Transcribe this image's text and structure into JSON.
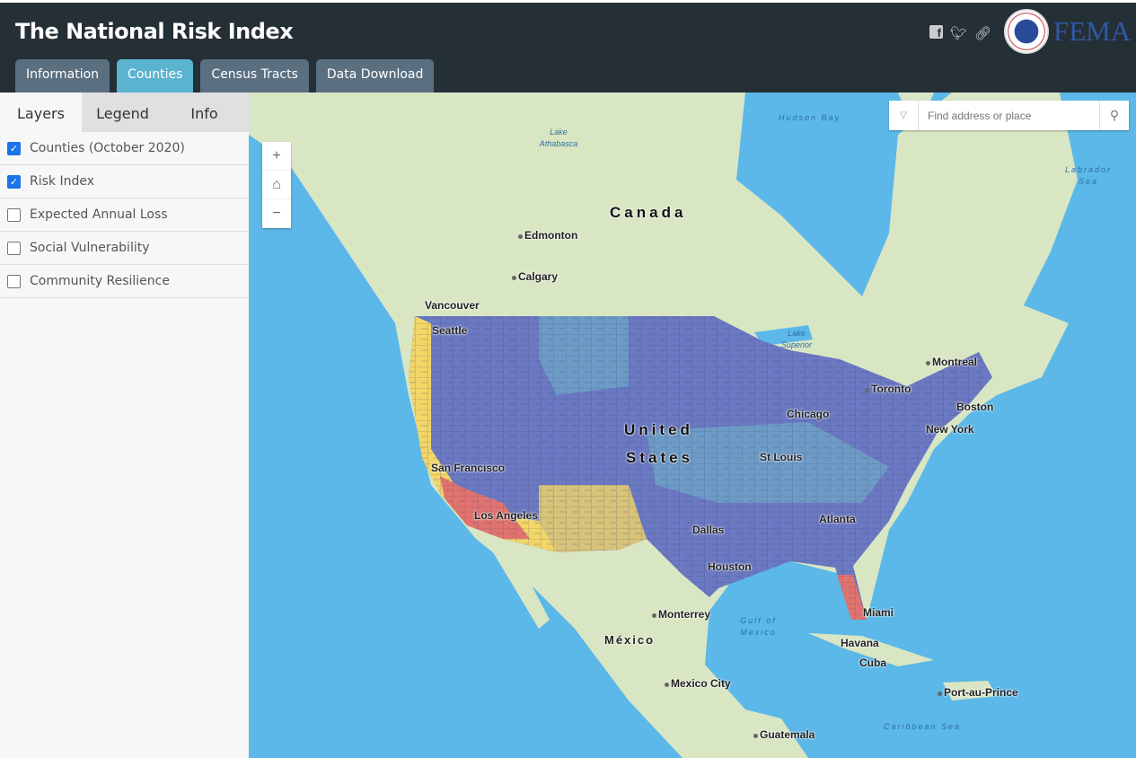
{
  "header": {
    "title": "The National Risk Index",
    "tabs": [
      "Information",
      "Counties",
      "Census Tracts",
      "Data Download"
    ],
    "active_tab": "Counties",
    "logo_text": "FEMA"
  },
  "sidebar": {
    "tabs": [
      "Layers",
      "Legend",
      "Info"
    ],
    "active_tab": "Layers",
    "layers": [
      {
        "label": "Counties (October 2020)",
        "checked": true
      },
      {
        "label": "Risk Index",
        "checked": true
      },
      {
        "label": "Expected Annual Loss",
        "checked": false
      },
      {
        "label": "Social Vulnerability",
        "checked": false
      },
      {
        "label": "Community Resilience",
        "checked": false
      }
    ]
  },
  "map": {
    "search_placeholder": "Find address or place",
    "zoom_in": "+",
    "home": "⌂",
    "zoom_out": "−",
    "colors": {
      "high": "#e0736f",
      "rel_high": "#f2d667",
      "moderate": "#6fa9c8",
      "low": "#6b79c2"
    },
    "labels": {
      "canada": "Canada",
      "united": "United",
      "states": "States",
      "mexico": "México",
      "cuba": "Cuba",
      "edmonton": "Edmonton",
      "calgary": "Calgary",
      "vancouver": "Vancouver",
      "seattle": "Seattle",
      "montreal": "Montreal",
      "toronto": "Toronto",
      "chicago": "Chicago",
      "boston": "Boston",
      "new_york": "New York",
      "st_louis": "St Louis",
      "san_francisco": "San Francisco",
      "los_angeles": "Los Angeles",
      "atlanta": "Atlanta",
      "dallas": "Dallas",
      "houston": "Houston",
      "miami": "Miami",
      "monterrey": "Monterrey",
      "havana": "Havana",
      "mexico_city": "Mexico City",
      "port_au_prince": "Port-au-Prince",
      "guatemala": "Guatemala"
    },
    "water": {
      "hudson_bay": "Hudson Bay",
      "labrador_sea": "Labrador Sea",
      "lake_athabasca": "Lake Athabasca",
      "lake_superior": "Lake Superior",
      "gulf_of_mexico": "Gulf of Mexico",
      "caribbean_sea": "Caribbean Sea"
    }
  }
}
